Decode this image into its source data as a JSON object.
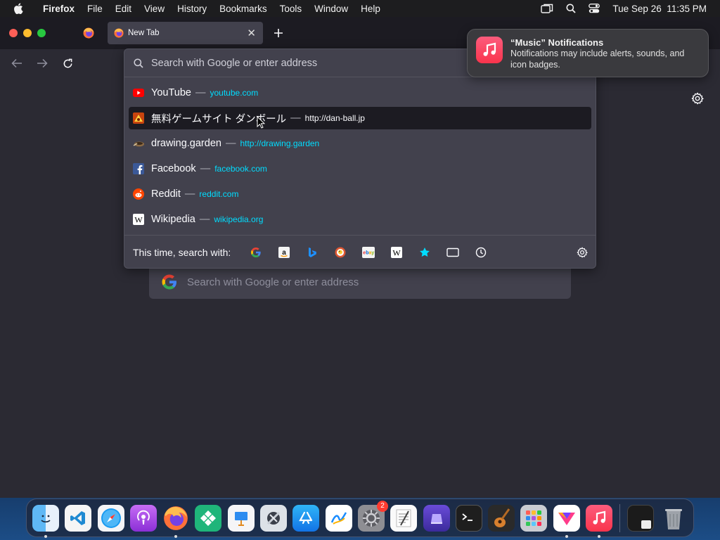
{
  "menubar": {
    "app_name": "Firefox",
    "items": [
      "File",
      "Edit",
      "View",
      "History",
      "Bookmarks",
      "Tools",
      "Window",
      "Help"
    ],
    "datetime": "Tue Sep 26  11:35 PM"
  },
  "browser": {
    "active_tab": {
      "title": "New Tab"
    },
    "urlbar": {
      "placeholder": "Search with Google or enter address"
    },
    "results": [
      {
        "title": "YouTube",
        "separator": "—",
        "url": "youtube.com",
        "icon": "youtube-icon",
        "selected": false
      },
      {
        "title": "無料ゲームサイト ダンボール",
        "separator": "—",
        "url": "http://dan-ball.jp",
        "icon": "dan-ball-icon",
        "selected": true
      },
      {
        "title": "drawing.garden",
        "separator": "—",
        "url": "http://drawing.garden",
        "icon": "drawing-garden-icon",
        "selected": false
      },
      {
        "title": "Facebook",
        "separator": "—",
        "url": "facebook.com",
        "icon": "facebook-icon",
        "selected": false
      },
      {
        "title": "Reddit",
        "separator": "—",
        "url": "reddit.com",
        "icon": "reddit-icon",
        "selected": false
      },
      {
        "title": "Wikipedia",
        "separator": "—",
        "url": "wikipedia.org",
        "icon": "wikipedia-icon",
        "selected": false
      }
    ],
    "oneoff_label": "This time, search with:",
    "oneoff_engines": [
      "google-icon",
      "amazon-icon",
      "bing-icon",
      "duckduckgo-icon",
      "ebay-icon",
      "wikipedia-icon",
      "bookmarks-star-icon",
      "tabs-icon",
      "history-clock-icon"
    ],
    "newtab_search": {
      "placeholder": "Search with Google or enter address"
    }
  },
  "notification": {
    "title": "“Music” Notifications",
    "body": "Notifications may include alerts, sounds, and icon badges."
  },
  "dock": {
    "apps": [
      "finder",
      "vscode",
      "safari",
      "podcasts",
      "firefox",
      "tableplus",
      "keynote",
      "xcode-instruments",
      "app-store",
      "freeform",
      "system-settings",
      "textedit",
      "simulator",
      "terminal",
      "garageband",
      "launchpad",
      "setapp",
      "music"
    ],
    "system_settings_badge": "2"
  },
  "colors": {
    "selection_url": "#fbfbfe",
    "result_url": "#00ddff",
    "panel_bg": "#42414d",
    "window_bg": "#2b2a33"
  }
}
